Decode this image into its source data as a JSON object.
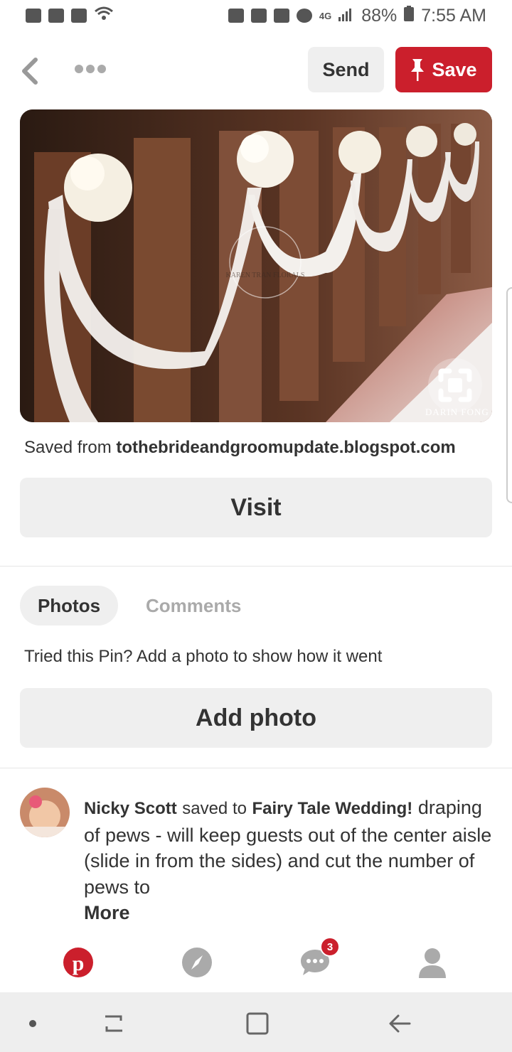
{
  "status_bar": {
    "battery": "88%",
    "time": "7:55 AM",
    "network": "4G"
  },
  "header": {
    "back_icon": "chevron-left-icon",
    "more_icon": "ellipsis-icon",
    "send_label": "Send",
    "save_label": "Save"
  },
  "pin": {
    "watermark": "KAREN TRAN FLORALS",
    "photo_credit": "DARIN FONG",
    "saved_from_prefix": "Saved from",
    "source_domain": "tothebrideandgroomupdate.blogspot.com",
    "visit_label": "Visit"
  },
  "tabs": {
    "photos": "Photos",
    "comments": "Comments"
  },
  "tried": {
    "prompt": "Tried this Pin? Add a photo to show how it went",
    "add_photo_label": "Add photo"
  },
  "activity": {
    "user_name": "Nicky Scott",
    "saved_to": "saved to",
    "board_name": "Fairy Tale Wedding!",
    "description": "draping of pews - will keep guests out of the center aisle (slide in from the sides) and cut the number of pews to",
    "more_label": "More"
  },
  "bottom_nav": {
    "items": [
      "pinterest-home-icon",
      "explore-compass-icon",
      "messages-icon",
      "profile-icon"
    ],
    "messages_badge": "3"
  },
  "colors": {
    "brand_red": "#cb1f2c",
    "button_gray": "#efefef"
  }
}
